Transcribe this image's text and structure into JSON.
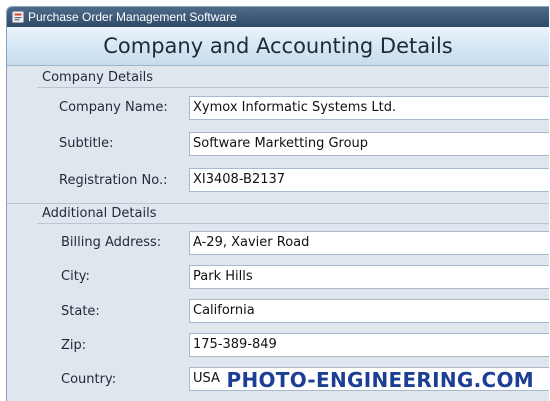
{
  "window": {
    "title": "Purchase Order Management Software",
    "icon": "app-icon"
  },
  "header": {
    "title": "Company and Accounting Details"
  },
  "company_details": {
    "section_label": "Company Details",
    "fields": [
      {
        "label": "Company Name:",
        "value": "Xymox Informatic Systems Ltd."
      },
      {
        "label": "Subtitle:",
        "value": "Software Marketting Group"
      },
      {
        "label": "Registration No.:",
        "value": "XI3408-B2137"
      }
    ]
  },
  "additional_details": {
    "section_label": "Additional Details",
    "fields": [
      {
        "label": "Billing Address:",
        "value": "A-29, Xavier Road"
      },
      {
        "label": "City:",
        "value": "Park Hills"
      },
      {
        "label": "State:",
        "value": "California"
      },
      {
        "label": "Zip:",
        "value": "175-389-849"
      },
      {
        "label": "Country:",
        "value": "USA"
      }
    ]
  },
  "watermark": {
    "text": "PHOTO-ENGINEERING.COM"
  },
  "colors": {
    "title_bar": "#3a5675",
    "header_bg": "#d6e7f5",
    "panel_bg": "#dfe6ee",
    "watermark": "#1c3f95"
  }
}
